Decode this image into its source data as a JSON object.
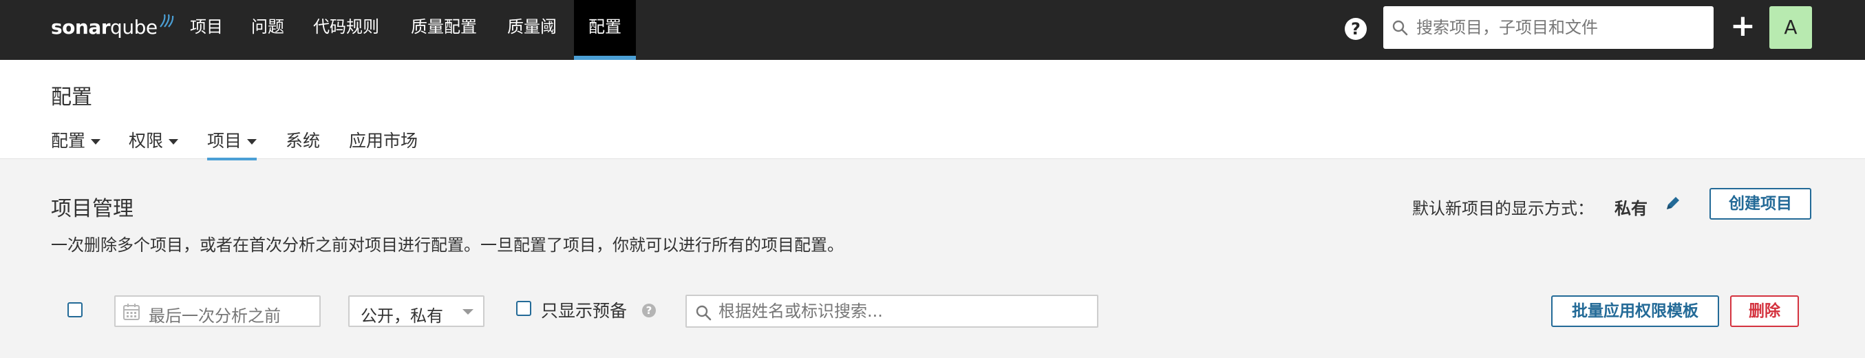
{
  "brand": {
    "logo_text_bold": "sonar",
    "logo_text_light": "qube"
  },
  "nav": {
    "items": [
      {
        "label": "项目",
        "active": false
      },
      {
        "label": "问题",
        "active": false
      },
      {
        "label": "代码规则",
        "active": false
      },
      {
        "label": "质量配置",
        "active": false
      },
      {
        "label": "质量阈",
        "active": false
      },
      {
        "label": "配置",
        "active": true
      }
    ],
    "help_icon": "help-circle-icon",
    "search_placeholder": "搜索项目，子项目和文件",
    "plus_icon": "plus-icon",
    "avatar_letter": "A"
  },
  "page": {
    "title": "配置",
    "tabs": [
      {
        "label": "配置",
        "dropdown": true,
        "active": false
      },
      {
        "label": "权限",
        "dropdown": true,
        "active": false
      },
      {
        "label": "项目",
        "dropdown": true,
        "active": true
      },
      {
        "label": "系统",
        "dropdown": false,
        "active": false
      },
      {
        "label": "应用市场",
        "dropdown": false,
        "active": false
      }
    ]
  },
  "projects": {
    "title": "项目管理",
    "description": "一次删除多个项目，或者在首次分析之前对项目进行配置。一旦配置了项目，你就可以进行所有的项目配置。",
    "default_visibility_label": "默认新项目的显示方式：",
    "default_visibility_value": "私有",
    "create_button": "创建项目"
  },
  "filters": {
    "date_placeholder": "最后一次分析之前",
    "visibility_select": "公开，私有",
    "provisioned_label": "只显示预备",
    "search_placeholder": "根据姓名或标识搜索...",
    "bulk_apply_button": "批量应用权限模板",
    "delete_button": "删除"
  },
  "colors": {
    "accent": "#4b9fd5",
    "primary": "#236a97",
    "danger": "#d4333f",
    "navbar": "#262626"
  }
}
